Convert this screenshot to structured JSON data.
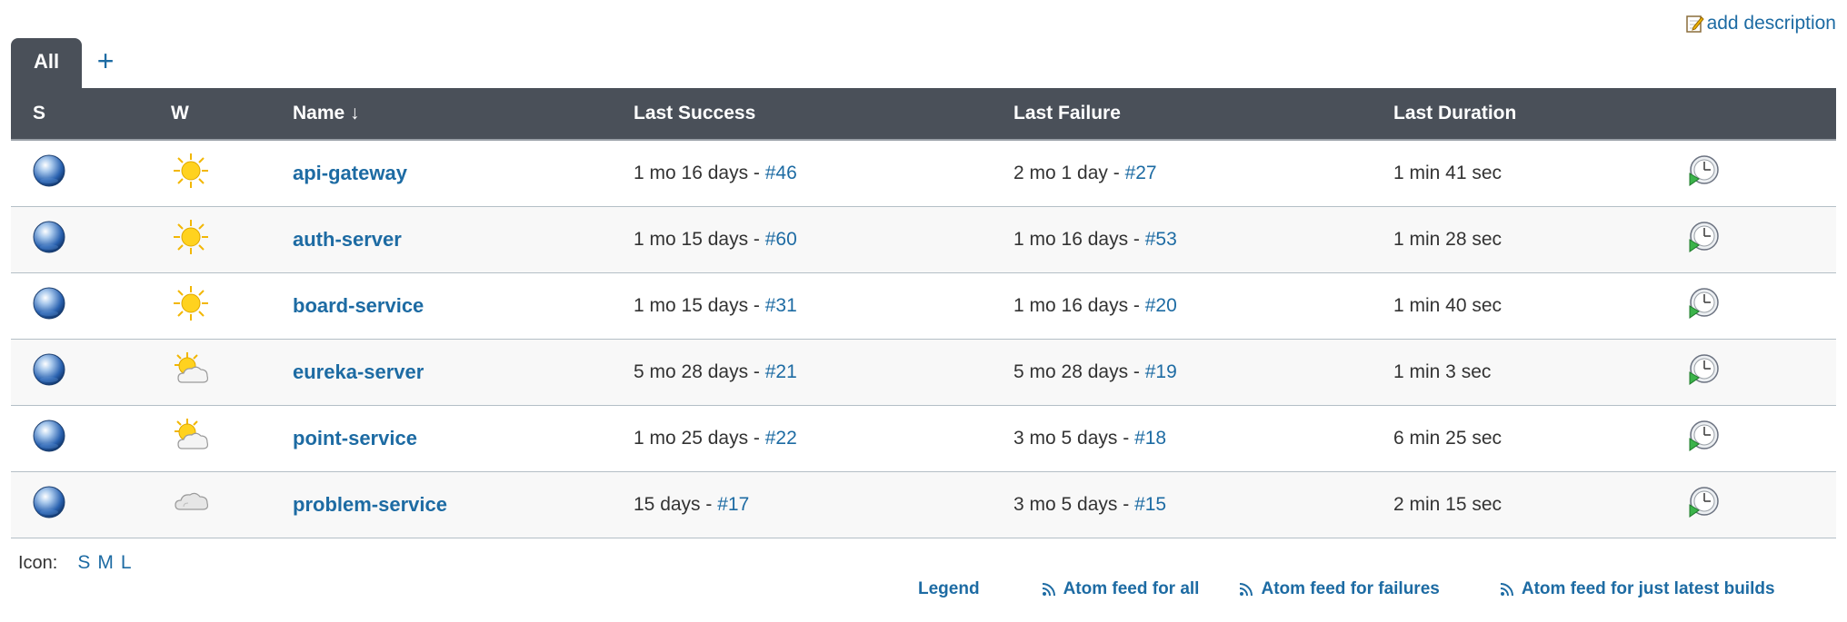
{
  "header": {
    "add_description": "add description"
  },
  "tabs": {
    "all_label": "All",
    "add_label": "+"
  },
  "table": {
    "columns": {
      "status": "S",
      "weather": "W",
      "name": "Name ↓",
      "last_success": "Last Success",
      "last_failure": "Last Failure",
      "last_duration": "Last Duration"
    },
    "rows": [
      {
        "status_icon": "blue-ball-icon",
        "weather_icon": "sun-icon",
        "name": "api-gateway",
        "last_success_time": "1 mo 16 days - ",
        "last_success_build": "#46",
        "last_failure_time": "2 mo 1 day - ",
        "last_failure_build": "#27",
        "duration": "1 min 41 sec"
      },
      {
        "status_icon": "blue-ball-icon",
        "weather_icon": "sun-icon",
        "name": "auth-server",
        "last_success_time": "1 mo 15 days - ",
        "last_success_build": "#60",
        "last_failure_time": "1 mo 16 days - ",
        "last_failure_build": "#53",
        "duration": "1 min 28 sec"
      },
      {
        "status_icon": "blue-ball-icon",
        "weather_icon": "sun-icon",
        "name": "board-service",
        "last_success_time": "1 mo 15 days - ",
        "last_success_build": "#31",
        "last_failure_time": "1 mo 16 days - ",
        "last_failure_build": "#20",
        "duration": "1 min 40 sec"
      },
      {
        "status_icon": "blue-ball-icon",
        "weather_icon": "partly-cloudy-icon",
        "name": "eureka-server",
        "last_success_time": "5 mo 28 days - ",
        "last_success_build": "#21",
        "last_failure_time": "5 mo 28 days - ",
        "last_failure_build": "#19",
        "duration": "1 min 3 sec"
      },
      {
        "status_icon": "blue-ball-icon",
        "weather_icon": "partly-cloudy-icon",
        "name": "point-service",
        "last_success_time": "1 mo 25 days - ",
        "last_success_build": "#22",
        "last_failure_time": "3 mo 5 days - ",
        "last_failure_build": "#18",
        "duration": "6 min 25 sec"
      },
      {
        "status_icon": "blue-ball-icon",
        "weather_icon": "cloudy-icon",
        "name": "problem-service",
        "last_success_time": "15 days - ",
        "last_success_build": "#17",
        "last_failure_time": "3 mo 5 days - ",
        "last_failure_build": "#15",
        "duration": "2 min 15 sec"
      }
    ]
  },
  "icon_size": {
    "label": "Icon:",
    "s": "S",
    "m": "M",
    "l": "L"
  },
  "footer": {
    "legend": "Legend",
    "atom_all": "Atom feed for all",
    "atom_failures": "Atom feed for failures",
    "atom_latest": "Atom feed for just latest builds"
  }
}
